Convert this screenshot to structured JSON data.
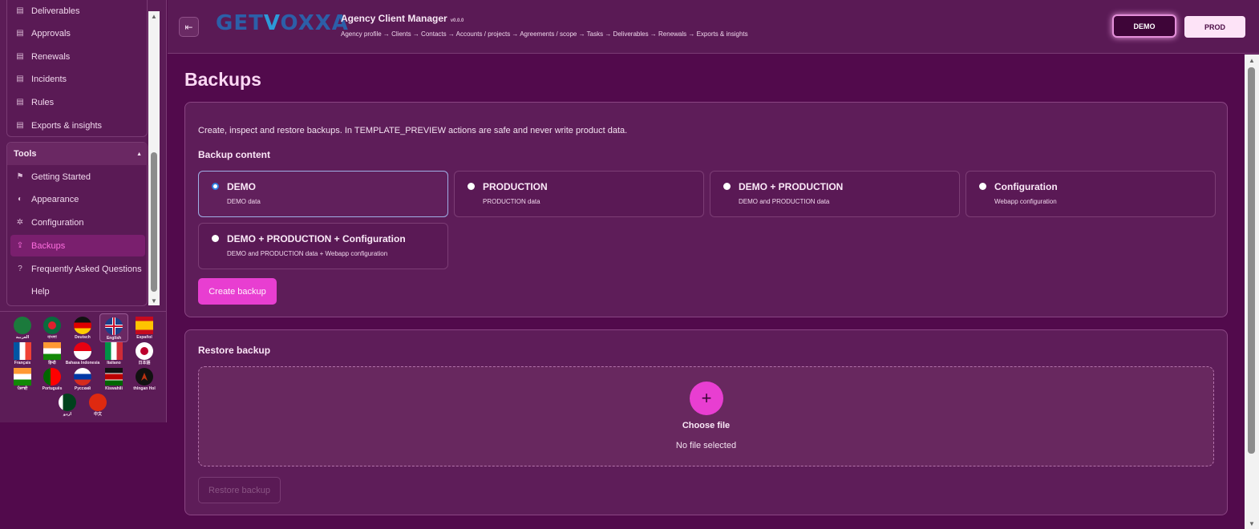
{
  "sidebar": {
    "partial_item": "Deliverables",
    "nav_items": [
      {
        "label": "Approvals",
        "icon": "list-icon"
      },
      {
        "label": "Renewals",
        "icon": "list-icon"
      },
      {
        "label": "Incidents",
        "icon": "list-icon"
      },
      {
        "label": "Rules",
        "icon": "list-icon"
      },
      {
        "label": "Exports & insights",
        "icon": "list-icon"
      }
    ],
    "tools_title": "Tools",
    "tools_items": [
      {
        "label": "Getting Started",
        "icon": "flag-icon"
      },
      {
        "label": "Appearance",
        "icon": "palette-icon"
      },
      {
        "label": "Configuration",
        "icon": "gear-icon"
      },
      {
        "label": "Backups",
        "icon": "upload-icon"
      },
      {
        "label": "Frequently Asked Questions",
        "icon": "help-icon"
      },
      {
        "label": "Help",
        "icon": ""
      }
    ],
    "active_tool": "Backups"
  },
  "languages": [
    {
      "name": "العربية",
      "code": "ar"
    },
    {
      "name": "বাংলা",
      "code": "bn"
    },
    {
      "name": "Deutsch",
      "code": "de"
    },
    {
      "name": "English",
      "code": "en",
      "selected": true
    },
    {
      "name": "Español",
      "code": "es"
    },
    {
      "name": "Français",
      "code": "fr"
    },
    {
      "name": "हिन्दी",
      "code": "hi"
    },
    {
      "name": "Bahasa Indonesia",
      "code": "id"
    },
    {
      "name": "Italiano",
      "code": "it"
    },
    {
      "name": "日本語",
      "code": "ja"
    },
    {
      "name": "ਪੰਜਾਬੀ",
      "code": "pa"
    },
    {
      "name": "Português",
      "code": "pt"
    },
    {
      "name": "Русский",
      "code": "ru"
    },
    {
      "name": "Kiswahili",
      "code": "sw"
    },
    {
      "name": "thlngan Hol",
      "code": "tlh"
    },
    {
      "name": "اردو",
      "code": "ur"
    },
    {
      "name": "中文",
      "code": "zh"
    }
  ],
  "header": {
    "logo_left": "GET",
    "logo_v": "V",
    "logo_right": "OXXA",
    "app_title": "Agency Client Manager",
    "version": "v0.0.0",
    "breadcrumb": "Agency profile → Clients → Contacts → Accounts / projects → Agreements / scope → Tasks → Deliverables → Renewals → Exports & insights",
    "env_demo": "DEMO",
    "env_prod": "PROD"
  },
  "main": {
    "page_title": "Backups",
    "description": "Create, inspect and restore backups. In TEMPLATE_PREVIEW actions are safe and never write product data.",
    "backup_content_title": "Backup content",
    "options": [
      {
        "title": "DEMO",
        "subtitle": "DEMO data",
        "selected": true
      },
      {
        "title": "PRODUCTION",
        "subtitle": "PRODUCTION data",
        "selected": false
      },
      {
        "title": "DEMO + PRODUCTION",
        "subtitle": "DEMO and PRODUCTION data",
        "selected": false
      },
      {
        "title": "Configuration",
        "subtitle": "Webapp configuration",
        "selected": false
      },
      {
        "title": "DEMO + PRODUCTION + Configuration",
        "subtitle": "DEMO and PRODUCTION data + Webapp configuration",
        "selected": false
      }
    ],
    "create_button": "Create backup",
    "restore_title": "Restore backup",
    "choose_file": "Choose file",
    "no_file": "No file selected",
    "restore_button": "Restore backup"
  },
  "colors": {
    "accent": "#e83ed1",
    "background": "#520a4c",
    "panel": "#5e1d59"
  }
}
